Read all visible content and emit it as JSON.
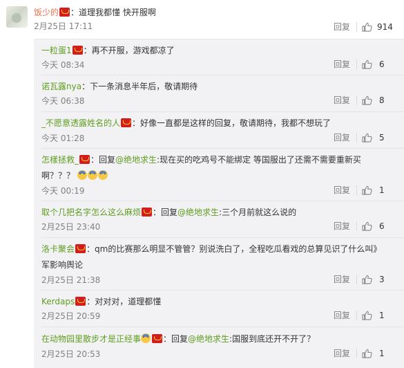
{
  "main_comment": {
    "username": "饭少的",
    "text": "：道理我都懂 快开服啊",
    "time": "2月25日 17:11",
    "reply_label": "回复",
    "likes": "914"
  },
  "replies": [
    {
      "username": "一粒蛋1",
      "prefix": "",
      "text": "：再不开服，游戏都凉了",
      "line2": "",
      "time": "今天 08:34",
      "reply_label": "回复",
      "likes": "6"
    },
    {
      "username": "诺瓦露nya",
      "prefix": "",
      "text": "：下一条消息半年后，敬请期待",
      "line2": "",
      "time": "今天 06:38",
      "reply_label": "回复",
      "likes": "8"
    },
    {
      "username": "_不愿意透露姓名的人",
      "prefix": "",
      "text": "：好像一直都是这样的回复，敬请期待，我都不想玩了",
      "line2": "",
      "time": "今天 01:28",
      "reply_label": "回复",
      "likes": "5"
    },
    {
      "username": "怎樣拯救_",
      "prefix": "：回复",
      "at": "@绝地求生",
      "text": ":现在买的吃鸡号不能绑定 等国服出了还需不需要重新买",
      "line2": "啊？？？",
      "time": "今天 00:19",
      "reply_label": "回复",
      "likes": "1"
    },
    {
      "username": "取个几把名字怎么这么麻烦",
      "prefix": "：回复",
      "at": "@绝地求生",
      "text": ":三个月前就这么说的",
      "line2": "",
      "time": "2月25日 23:40",
      "reply_label": "回复",
      "likes": "6"
    },
    {
      "username": "洛卡聚会",
      "prefix": "",
      "text": "：qm的比赛那么明显不管管？别说洗白了，全程吃瓜看戏的总算见识了什么叫》",
      "line2": "军影响舆论",
      "time": "2月25日 21:38",
      "reply_label": "回复",
      "likes": "3"
    },
    {
      "username": "Kerdaps",
      "prefix": "",
      "text": "：对对对，道理都懂",
      "line2": "",
      "time": "2月25日 20:59",
      "reply_label": "回复",
      "likes": "1"
    },
    {
      "username": "在动物园里散步才是正经事",
      "prefix": "：回复",
      "at": "@绝地求生",
      "text": ":国服到底还开不开了？",
      "line2": "",
      "time": "2月25日 20:53",
      "reply_label": "回复",
      "likes": "1"
    }
  ],
  "icons": {
    "thumb": "thumb-up-icon",
    "badge": "vip-badge-icon",
    "emoji": "emoji-icon"
  },
  "colors": {
    "username_main": "#eb7350",
    "username_reply": "#5f9d1f",
    "box_background": "#f2f2f5"
  }
}
